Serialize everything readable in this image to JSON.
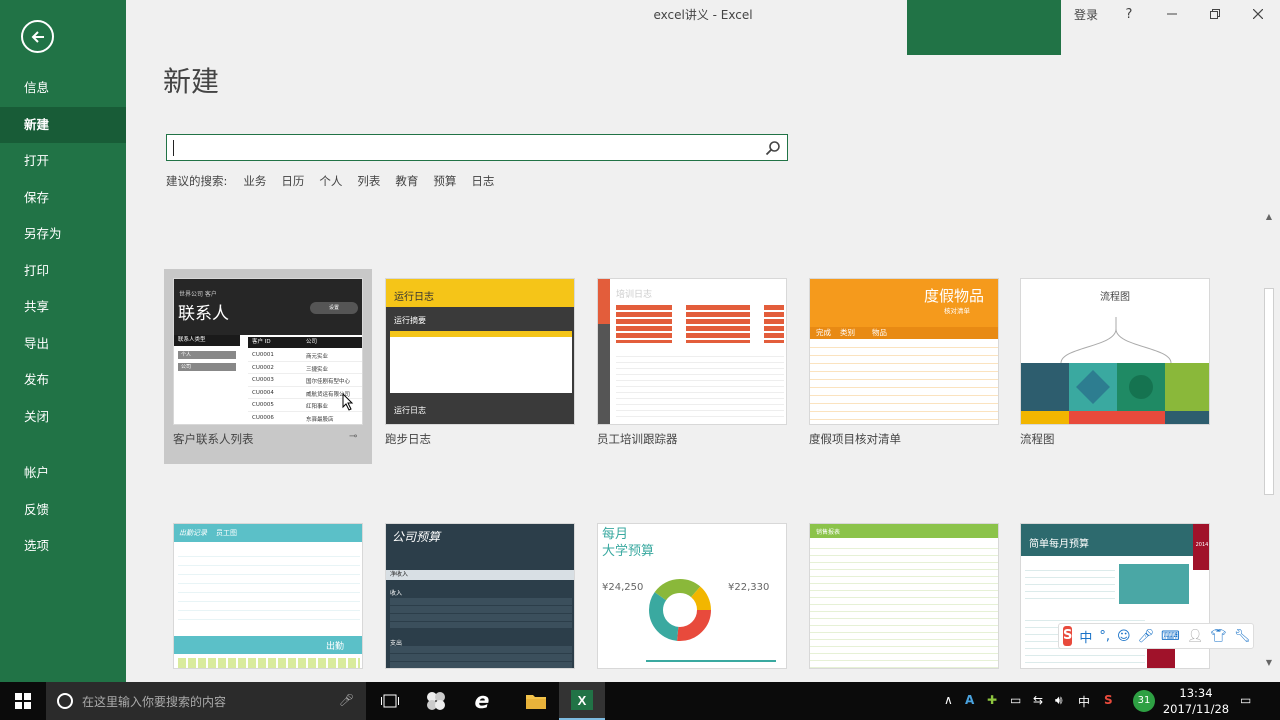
{
  "window": {
    "title": "excel讲义  -  Excel",
    "signin": "登录",
    "help": "?",
    "minimize": "—",
    "restore": "❐",
    "close": "✕"
  },
  "sidebar": {
    "items": [
      {
        "label": "信息"
      },
      {
        "label": "新建"
      },
      {
        "label": "打开"
      },
      {
        "label": "保存"
      },
      {
        "label": "另存为"
      },
      {
        "label": "打印"
      },
      {
        "label": "共享"
      },
      {
        "label": "导出"
      },
      {
        "label": "发布"
      },
      {
        "label": "关闭"
      }
    ],
    "items2": [
      {
        "label": "帐户"
      },
      {
        "label": "反馈"
      },
      {
        "label": "选项"
      }
    ]
  },
  "main": {
    "heading": "新建",
    "search_value": "",
    "suggest_label": "建议的搜索:",
    "suggestions": [
      "业务",
      "日历",
      "个人",
      "列表",
      "教育",
      "预算",
      "日志"
    ]
  },
  "templates": [
    {
      "caption": "客户联系人列表",
      "pin": "⊸",
      "t_sub": "世界公司 客户",
      "t_title": "联系人",
      "t_btn": "设置",
      "t_filter1": "联系人类型",
      "t_filter_a": "个人",
      "t_filter_b": "公司",
      "t_col1": "客户 ID",
      "t_col2": "公司",
      "rows": [
        {
          "id": "CU0001",
          "co": "商元实业"
        },
        {
          "id": "CU0002",
          "co": "三捷实业"
        },
        {
          "id": "CU0003",
          "co": "国尔佳剧有型中心"
        },
        {
          "id": "CU0004",
          "co": "威航货运有限公司"
        },
        {
          "id": "CU0005",
          "co": "红阳事业"
        },
        {
          "id": "CU0006",
          "co": "东驿最股店"
        }
      ]
    },
    {
      "caption": "跑步日志",
      "t_title": "运行日志",
      "t_sub": "运行摘要",
      "t_foot": "运行日志"
    },
    {
      "caption": "员工培训跟踪器",
      "t_title": "培训日志"
    },
    {
      "caption": "度假项目核对清单",
      "t_title": "度假物品",
      "t_sub": "核对清单",
      "t_c1": "完成",
      "t_c2": "类别",
      "t_c3": "物品"
    },
    {
      "caption": "流程图",
      "t_title": "流程图"
    },
    {
      "t_title": "出勤记录",
      "t_title2": "员工图",
      "t_foot": "出勤"
    },
    {
      "t_title": "公司预算",
      "t_row1": "净收入",
      "t_row2": "收入",
      "t_row3": "支出"
    },
    {
      "t_title": "每月",
      "t_title2": "大学预算",
      "t_left": "¥24,250",
      "t_right": "¥22,330"
    },
    {
      "t_title": "销售报表"
    },
    {
      "t_title": "简单每月预算",
      "t_badge": "2014"
    }
  ],
  "ime": {
    "logo": "S",
    "lang": "中",
    "punct": "°,"
  },
  "taskbar": {
    "search_placeholder": "在这里输入你要搜索的内容",
    "time": "13:34",
    "date": "2017/11/28",
    "input_lang": "中",
    "notif_count": "31"
  },
  "colors": {
    "excel_green": "#217346",
    "excel_green_dark": "#185c37"
  }
}
